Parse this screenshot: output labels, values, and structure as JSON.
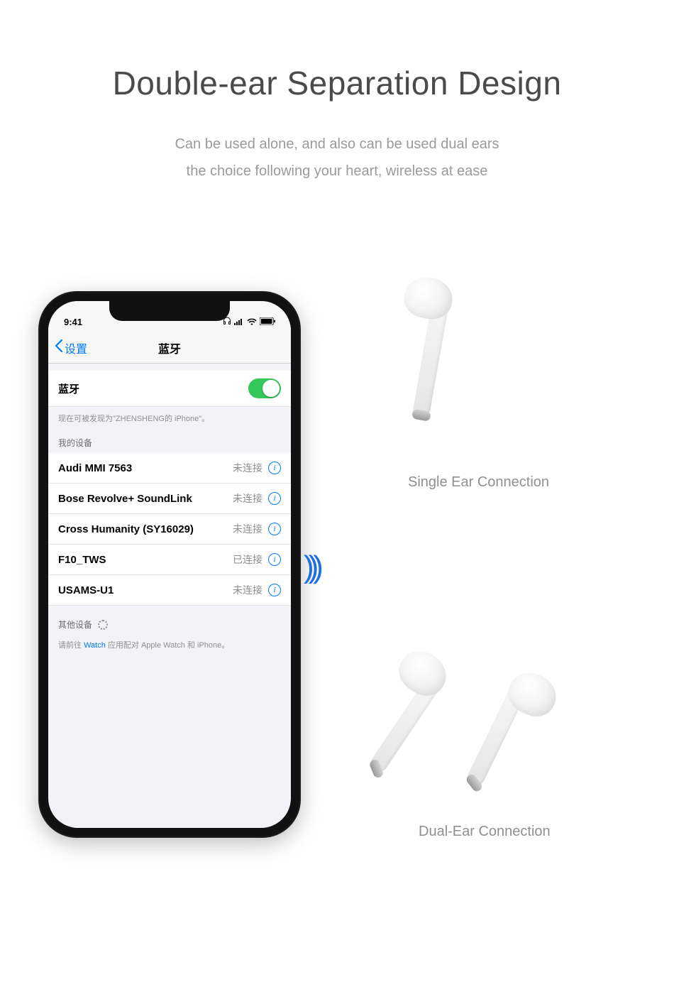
{
  "hero": {
    "title": "Double-ear Separation Design",
    "sub1": "Can be used alone, and also can be used dual ears",
    "sub2": "the choice following your heart, wireless at ease"
  },
  "phone": {
    "status": {
      "time": "9:41"
    },
    "nav": {
      "back": "设置",
      "title": "蓝牙"
    },
    "bt": {
      "label": "蓝牙",
      "hint": "现在可被发现为\"ZHENSHENG的 iPhone\"。",
      "mine": "我的设备",
      "other": "其他设备",
      "foot_pre": "请前往 ",
      "foot_link": "Watch",
      "foot_post": " 应用配对 Apple Watch 和 iPhone。"
    },
    "devices": [
      {
        "name": "Audi MMI 7563",
        "status": "未连接"
      },
      {
        "name": "Bose Revolve+ SoundLink",
        "status": "未连接"
      },
      {
        "name": "Cross Humanity (SY16029)",
        "status": "未连接"
      },
      {
        "name": "F10_TWS",
        "status": "已连接"
      },
      {
        "name": "USAMS-U1",
        "status": "未连接"
      }
    ]
  },
  "captions": {
    "single": "Single Ear Connection",
    "dual": "Dual-Ear Connection"
  }
}
